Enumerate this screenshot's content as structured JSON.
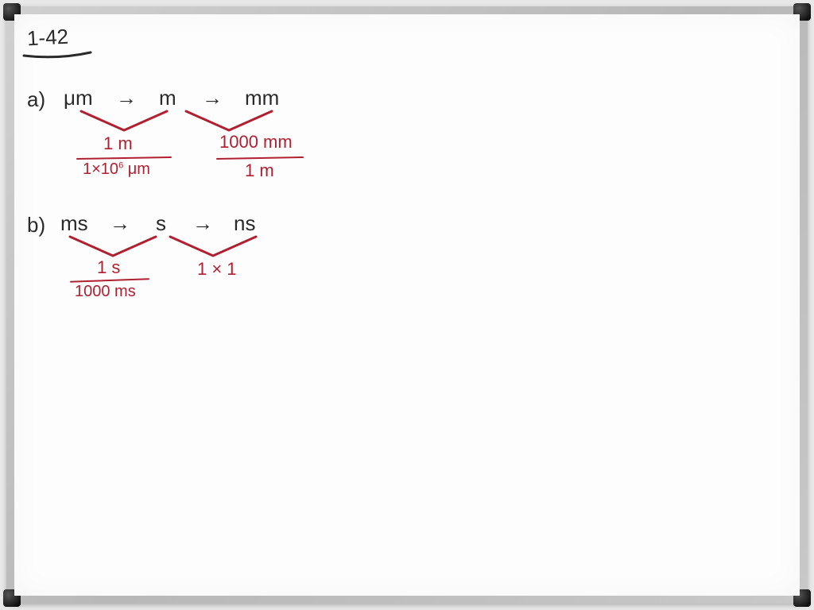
{
  "title": "1-42",
  "partA": {
    "label": "a)",
    "chain": [
      "μm",
      "→",
      "m",
      "→",
      "mm"
    ],
    "factor1": {
      "num": "1 m",
      "den": "1 × 10⁶ μm"
    },
    "factor2": {
      "num": "1000 mm",
      "den": "1 m"
    }
  },
  "partB": {
    "label": "b)",
    "chain": [
      "ms",
      "→",
      "s",
      "→",
      "ns"
    ],
    "factor1": {
      "num": "1 s",
      "den": "1000 ms"
    },
    "factor2": {
      "text": "1 × 1"
    }
  }
}
